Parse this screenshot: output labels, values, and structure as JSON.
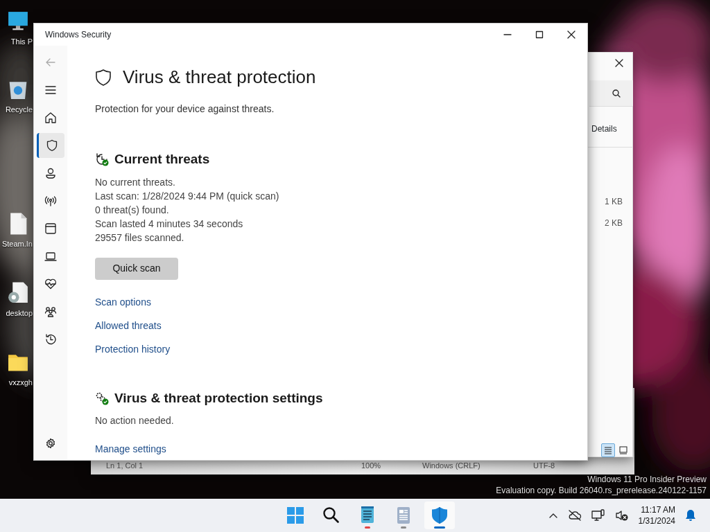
{
  "desktop_icons": [
    {
      "kind": "pc",
      "label": "This P"
    },
    {
      "kind": "recycle",
      "label": "Recycle"
    },
    {
      "kind": "file",
      "label": "Steam.In"
    },
    {
      "kind": "settings-file",
      "label": "desktop"
    },
    {
      "kind": "folder",
      "label": "vxzxgh"
    }
  ],
  "explorer": {
    "tab": "Details",
    "sizes": [
      "1 KB",
      "2 KB"
    ],
    "views": [
      {
        "kind": "details",
        "selected": true
      },
      {
        "kind": "tiles",
        "selected": false
      }
    ]
  },
  "notepad_status": [
    "Ln 1, Col 1",
    "100%",
    "Windows (CRLF)",
    "UTF-8"
  ],
  "window": {
    "title": "Windows Security"
  },
  "nav": [
    {
      "kind": "home",
      "selected": false
    },
    {
      "kind": "shield",
      "selected": true
    },
    {
      "kind": "account",
      "selected": false
    },
    {
      "kind": "firewall",
      "selected": false
    },
    {
      "kind": "app",
      "selected": false
    },
    {
      "kind": "device",
      "selected": false
    },
    {
      "kind": "health",
      "selected": false
    },
    {
      "kind": "family",
      "selected": false
    },
    {
      "kind": "history",
      "selected": false
    }
  ],
  "page": {
    "title": "Virus & threat protection",
    "subtitle": "Protection for your device against threats."
  },
  "sections": [
    {
      "kind": "threats",
      "title": "Current threats",
      "lines": [
        "No current threats.",
        "Last scan: 1/28/2024 9:44 PM (quick scan)",
        "0 threat(s) found.",
        "Scan lasted 4 minutes 34 seconds",
        "29557 files scanned."
      ],
      "button": "Quick scan",
      "links": [
        "Scan options",
        "Allowed threats",
        "Protection history"
      ]
    },
    {
      "kind": "settings",
      "title": "Virus & threat protection settings",
      "lines": [
        "No action needed."
      ],
      "links": [
        "Manage settings"
      ]
    }
  ],
  "watermark": [
    "Windows 11 Pro Insider Preview",
    "Evaluation copy. Build 26040.rs_prerelease.240122-1157"
  ],
  "taskbar": {
    "apps": [
      {
        "kind": "start",
        "open": false,
        "selected": false
      },
      {
        "kind": "search",
        "open": false,
        "selected": false
      },
      {
        "kind": "notepad",
        "open": true,
        "selected": false,
        "color": "#e04646"
      },
      {
        "kind": "document",
        "open": true,
        "selected": false,
        "color": "#8a8a8a"
      },
      {
        "kind": "security",
        "open": true,
        "selected": true,
        "color": "#0067c0"
      }
    ],
    "time": "11:17 AM",
    "date": "1/31/2024"
  }
}
